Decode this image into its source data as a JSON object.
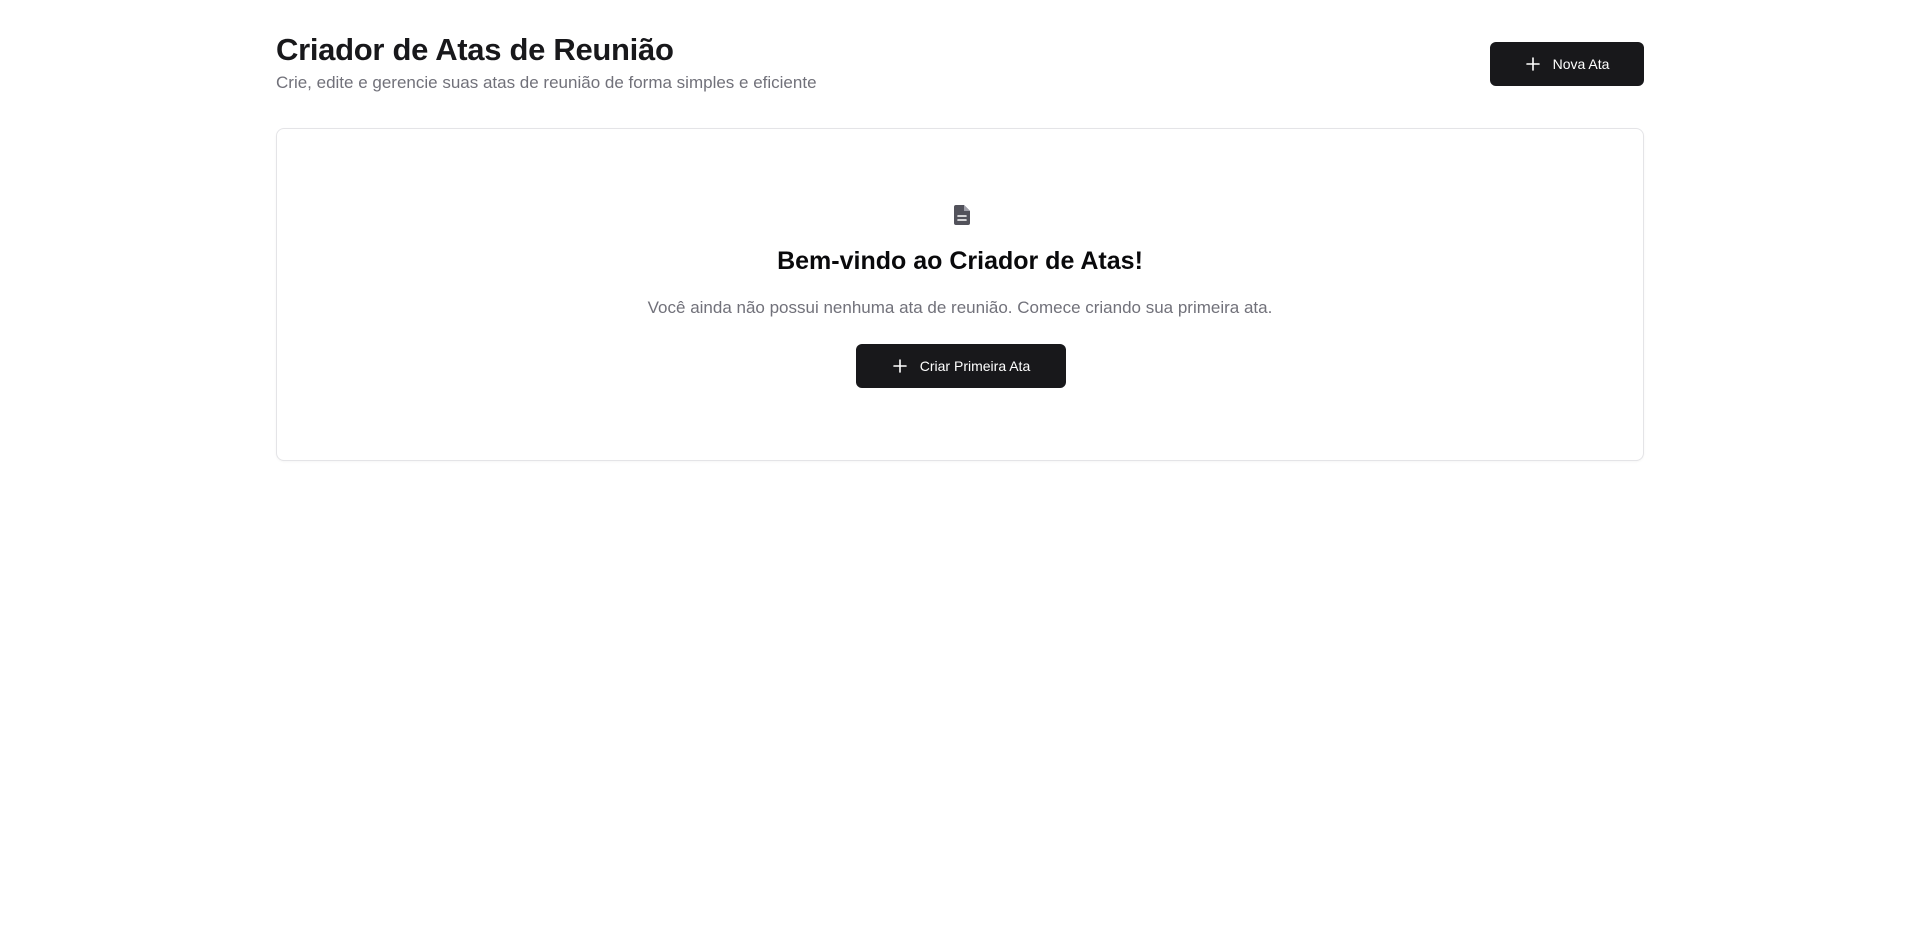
{
  "header": {
    "title": "Criador de Atas de Reunião",
    "subtitle": "Crie, edite e gerencie suas atas de reunião de forma simples e eficiente",
    "new_button_label": "Nova Ata",
    "new_button_icon": "plus-icon"
  },
  "empty_state": {
    "icon": "document-icon",
    "title": "Bem-vindo ao Criador de Atas!",
    "message": "Você ainda não possui nenhuma ata de reunião. Comece criando sua primeira ata.",
    "create_button_label": "Criar Primeira Ata",
    "create_button_icon": "plus-icon"
  },
  "colors": {
    "primary_button": "#18181b",
    "muted_text": "#71717a",
    "border": "#e4e4e7",
    "icon": "#52525b"
  }
}
